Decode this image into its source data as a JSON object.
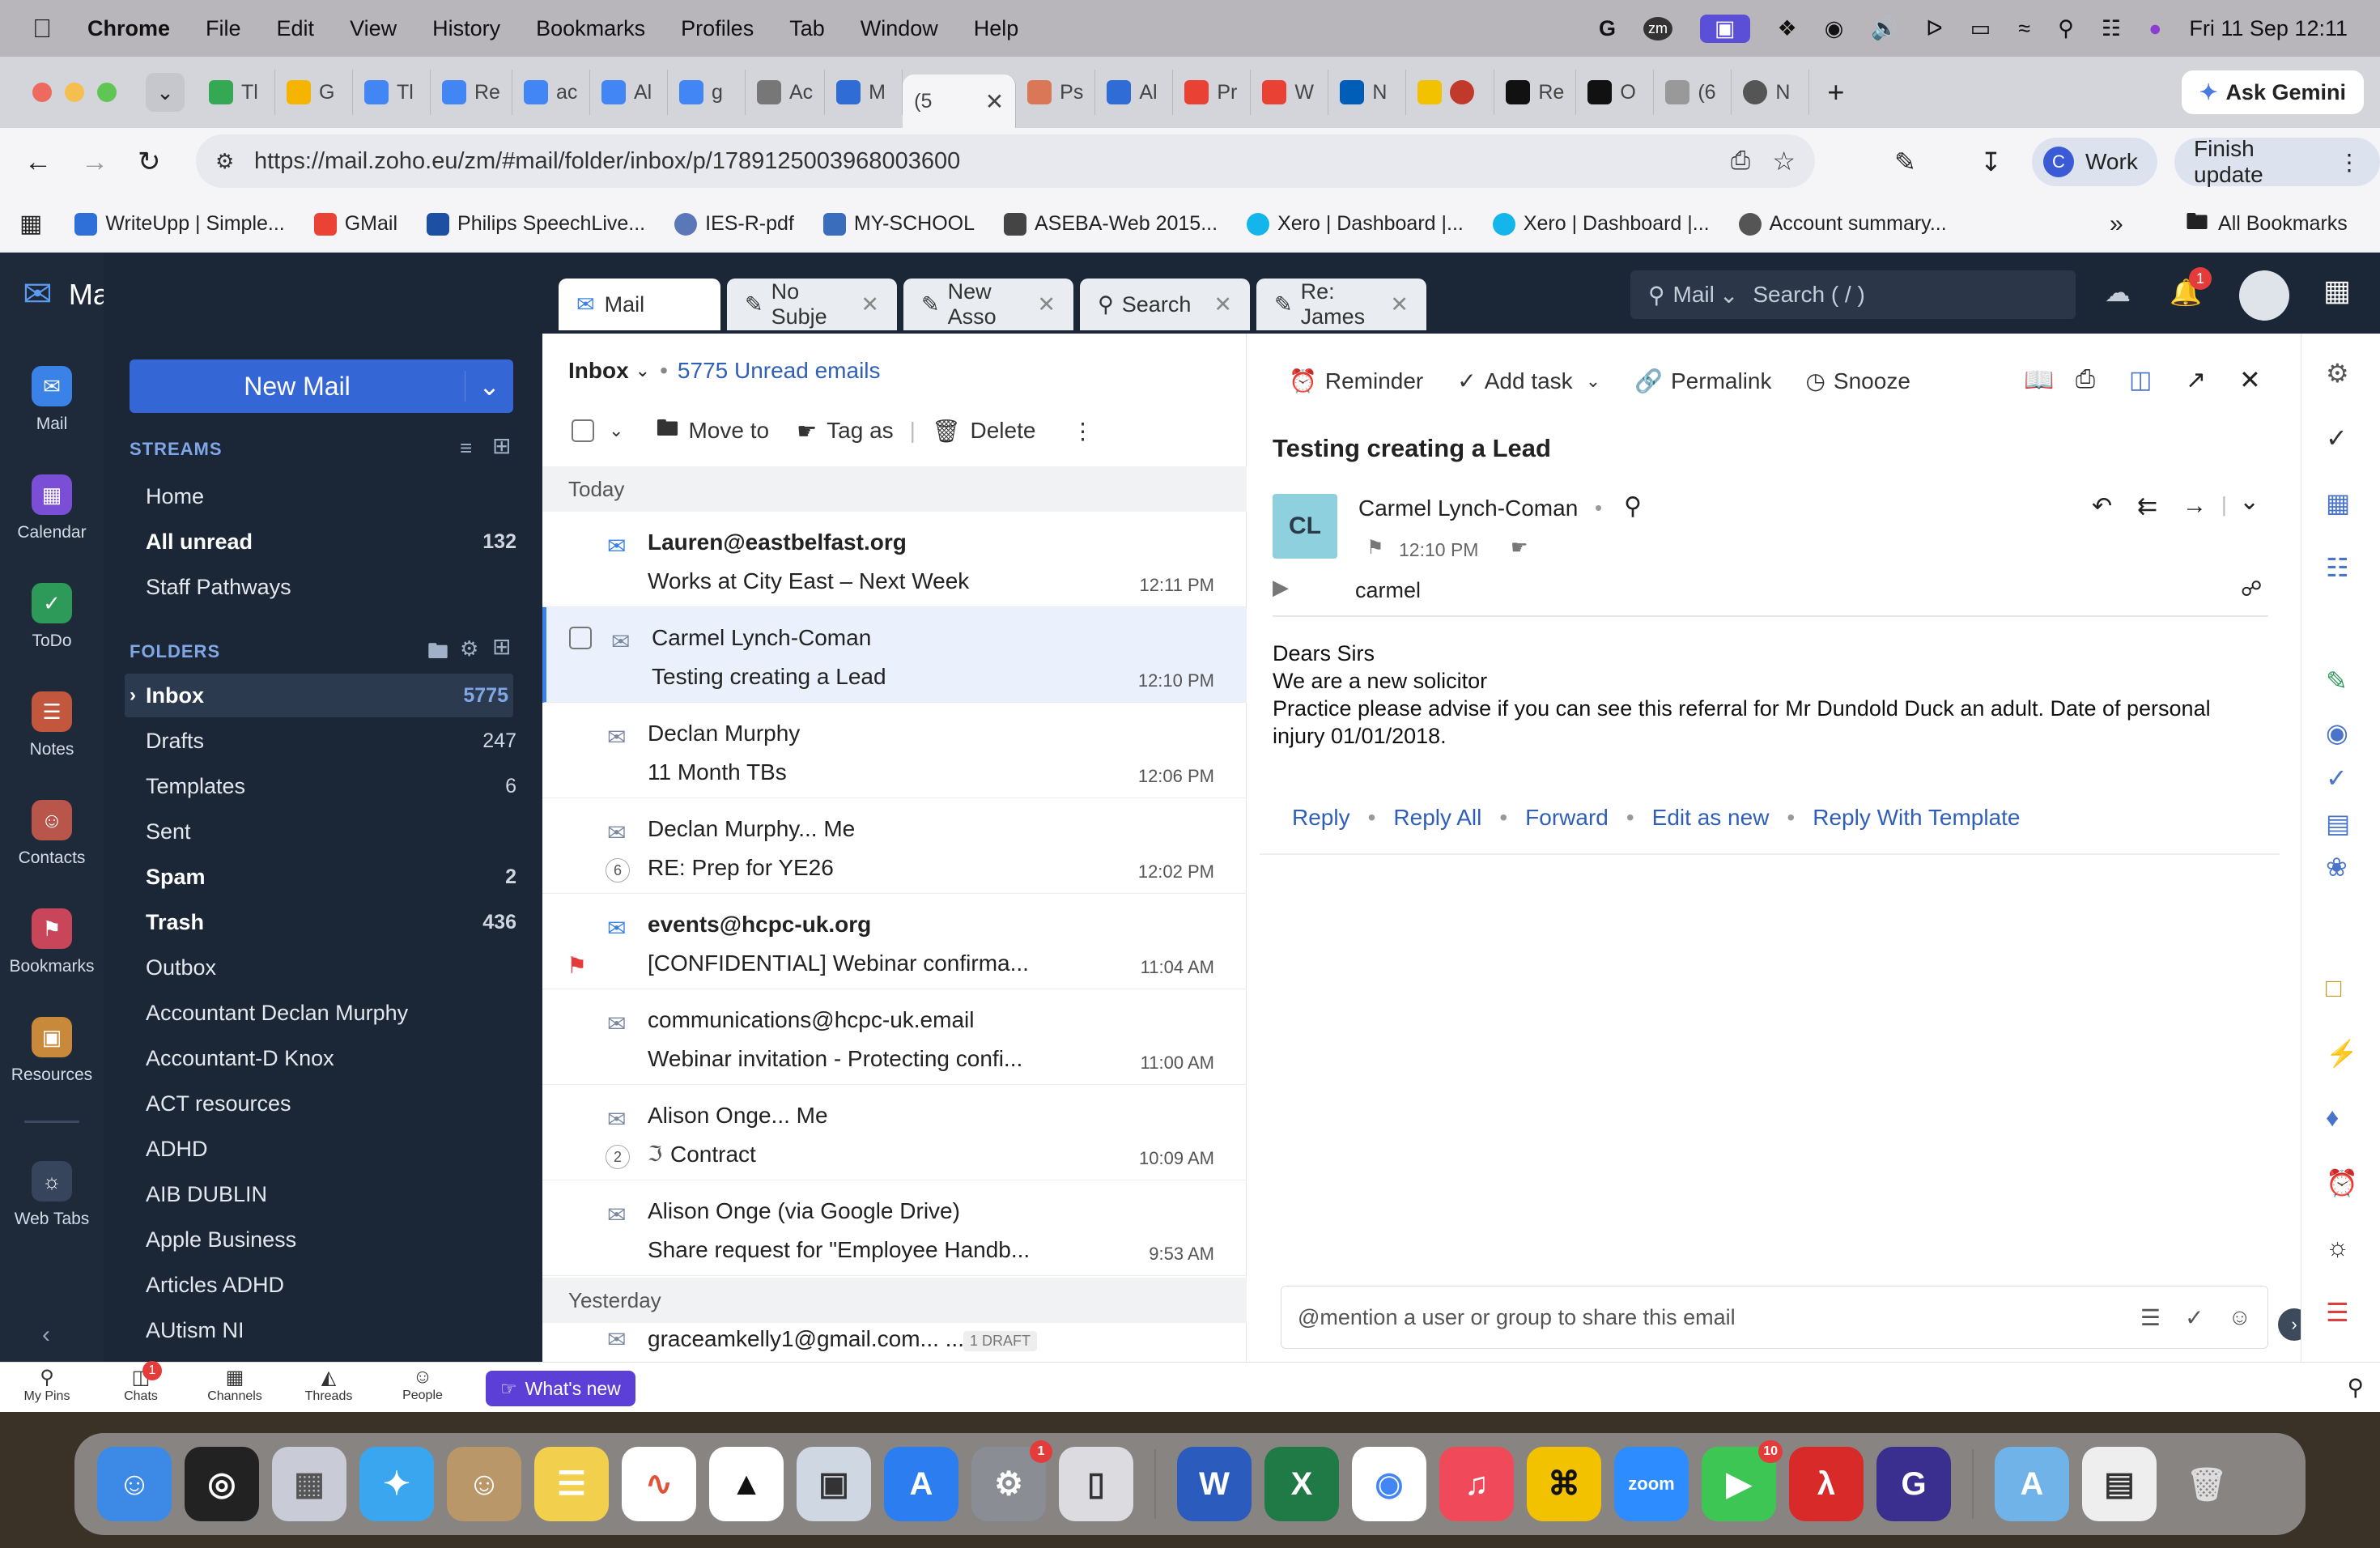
{
  "menubar": {
    "app": "Chrome",
    "items": [
      "File",
      "Edit",
      "View",
      "History",
      "Bookmarks",
      "Profiles",
      "Tab",
      "Window",
      "Help"
    ],
    "clock": "Fri 11 Sep  12:11"
  },
  "browser": {
    "tabs": [
      "Tl",
      "G",
      "Tl",
      "Re",
      "ac",
      "Al",
      "g",
      "Ac",
      "M",
      "(5",
      "Ps",
      "Al",
      "Pr",
      "W",
      "N",
      "",
      "Re",
      "O",
      "(6",
      "N"
    ],
    "ask_gemini": "Ask Gemini",
    "url": "https://mail.zoho.eu/zm/#mail/folder/inbox/p/1789125003968003600",
    "profile": "Work",
    "finish_update": "Finish update",
    "bookmarks": [
      "WriteUpp | Simple...",
      "GMail",
      "Philips SpeechLive...",
      "IES-R-pdf",
      "MY-SCHOOL",
      "ASEBA-Web 2015...",
      "Xero | Dashboard |...",
      "Xero | Dashboard |...",
      "Account summary..."
    ],
    "all_bookmarks": "All Bookmarks"
  },
  "zoho": {
    "brand": "Mail",
    "search_scope": "Mail",
    "search_placeholder": "Search ( / )",
    "notif_count": "1",
    "rail": [
      {
        "label": "Mail"
      },
      {
        "label": "Calendar"
      },
      {
        "label": "ToDo"
      },
      {
        "label": "Notes"
      },
      {
        "label": "Contacts"
      },
      {
        "label": "Bookmarks"
      },
      {
        "label": "Resources"
      },
      {
        "label": "Web Tabs"
      }
    ],
    "new_mail": "New Mail",
    "streams_title": "STREAMS",
    "streams": [
      {
        "label": "Home",
        "count": ""
      },
      {
        "label": "All unread",
        "count": "132"
      },
      {
        "label": "Staff Pathways",
        "count": ""
      }
    ],
    "folders_title": "FOLDERS",
    "folders": [
      {
        "label": "Inbox",
        "count": "5775"
      },
      {
        "label": "Drafts",
        "count": "247"
      },
      {
        "label": "Templates",
        "count": "6"
      },
      {
        "label": "Sent",
        "count": ""
      },
      {
        "label": "Spam",
        "count": "2"
      },
      {
        "label": "Trash",
        "count": "436"
      },
      {
        "label": "Outbox",
        "count": ""
      },
      {
        "label": "Accountant Declan Murphy",
        "count": ""
      },
      {
        "label": "Accountant-D Knox",
        "count": ""
      },
      {
        "label": "ACT resources",
        "count": ""
      },
      {
        "label": "ADHD",
        "count": ""
      },
      {
        "label": "AIB DUBLIN",
        "count": ""
      },
      {
        "label": "Apple Business",
        "count": ""
      },
      {
        "label": "Articles ADHD",
        "count": ""
      },
      {
        "label": "AUtism NI",
        "count": ""
      }
    ],
    "tabs": [
      "Mail",
      "No Subje",
      "New Asso",
      "Search",
      "Re: James"
    ],
    "list": {
      "folder": "Inbox",
      "unread": "5775 Unread emails",
      "toolbar": {
        "move": "Move to",
        "tag": "Tag as",
        "delete": "Delete"
      },
      "today": "Today",
      "yesterday": "Yesterday",
      "rows": [
        {
          "from": "Lauren@eastbelfast.org",
          "subject": "Works at City East – Next Week",
          "time": "12:11 PM",
          "count": ""
        },
        {
          "from": "Carmel Lynch-Coman",
          "subject": "Testing creating a Lead",
          "time": "12:10 PM",
          "count": ""
        },
        {
          "from": "Declan Murphy",
          "subject": "11 Month TBs",
          "time": "12:06 PM",
          "count": ""
        },
        {
          "from": "Declan Murphy... Me",
          "subject": "RE: Prep for YE26",
          "time": "12:02 PM",
          "count": "6"
        },
        {
          "from": "events@hcpc-uk.org",
          "subject": "[CONFIDENTIAL] Webinar confirma...",
          "time": "11:04 AM",
          "count": ""
        },
        {
          "from": "communications@hcpc-uk.email",
          "subject": "Webinar invitation - Protecting confi...",
          "time": "11:00 AM",
          "count": ""
        },
        {
          "from": "Alison Onge... Me",
          "subject": "Contract",
          "time": "10:09 AM",
          "count": "2"
        },
        {
          "from": "Alison Onge (via Google Drive)",
          "subject": "Share request for \"Employee Handb...",
          "time": "9:53 AM",
          "count": ""
        }
      ],
      "last_row": "graceamkelly1@gmail.com... ...",
      "draft_badge": "1 DRAFT"
    },
    "reader": {
      "toolbar": {
        "reminder": "Reminder",
        "task": "Add task",
        "permalink": "Permalink",
        "snooze": "Snooze"
      },
      "subject": "Testing creating a Lead",
      "avatar": "CL",
      "sender": "Carmel Lynch-Coman",
      "time": "12:10 PM",
      "to": "carmel",
      "body": [
        "Dears Sirs",
        "We are a new solicitor",
        "Practice please advise if you can see this referral for Mr Dundold Duck an adult.  Date of personal injury 01/01/2018."
      ],
      "actions": [
        "Reply",
        "Reply All",
        "Forward",
        "Edit as new",
        "Reply With Template"
      ],
      "mention_placeholder": "@mention a user or group to share this email"
    },
    "bottom": [
      {
        "label": "My Pins"
      },
      {
        "label": "Chats"
      },
      {
        "label": "Channels"
      },
      {
        "label": "Threads"
      },
      {
        "label": "People"
      }
    ],
    "whats_new": "What's new",
    "chats_badge": "1"
  },
  "dock": {
    "settings_badge": "1",
    "facetime_badge": "10",
    "zoom_label": "zoom"
  }
}
